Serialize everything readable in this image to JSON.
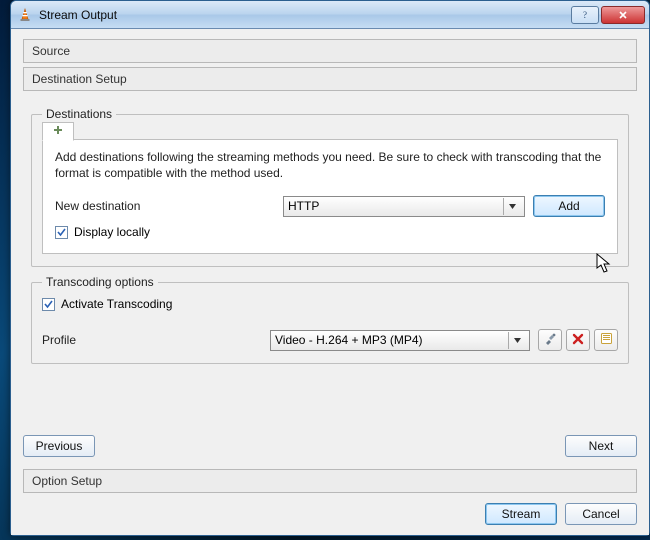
{
  "window": {
    "title": "Stream Output"
  },
  "sections": {
    "source": "Source",
    "destination_setup": "Destination Setup",
    "option_setup": "Option Setup"
  },
  "destinations": {
    "legend": "Destinations",
    "help": "Add destinations following the streaming methods you need. Be sure to check with transcoding that the format is compatible with the method used.",
    "new_destination_label": "New destination",
    "new_destination_value": "HTTP",
    "add_label": "Add",
    "display_locally_label": "Display locally",
    "display_locally_checked": true
  },
  "transcoding": {
    "legend": "Transcoding options",
    "activate_label": "Activate Transcoding",
    "activate_checked": true,
    "profile_label": "Profile",
    "profile_value": "Video - H.264 + MP3 (MP4)"
  },
  "nav": {
    "previous": "Previous",
    "next": "Next"
  },
  "footer": {
    "stream": "Stream",
    "cancel": "Cancel"
  },
  "icons": {
    "app": "vlc-cone-icon",
    "help": "help-icon",
    "close": "close-icon",
    "plus": "plus-icon",
    "dropdown": "chevron-down-icon",
    "tools": "tools-icon",
    "delete": "delete-icon",
    "save": "save-icon"
  }
}
